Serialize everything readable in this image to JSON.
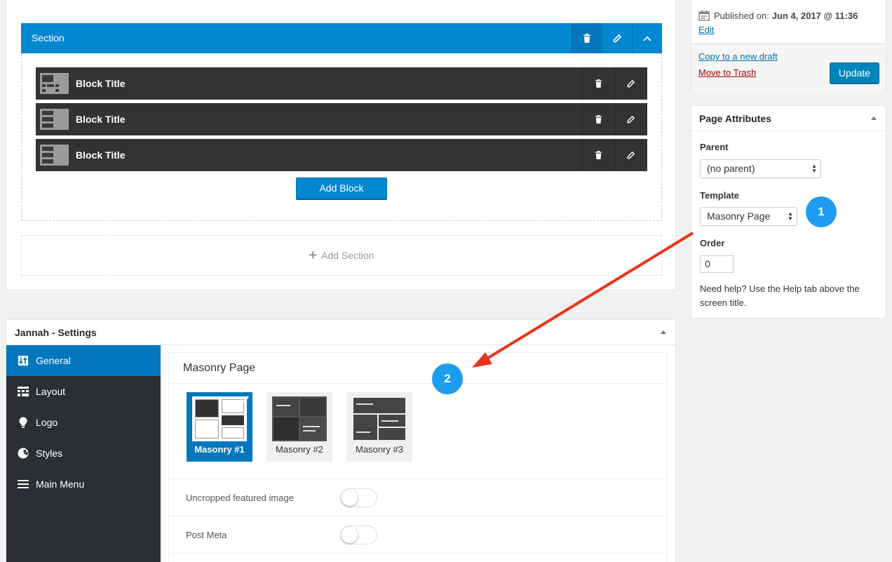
{
  "builder": {
    "section_label": "Section",
    "blocks": [
      {
        "title": "Block Title"
      },
      {
        "title": "Block Title"
      },
      {
        "title": "Block Title"
      }
    ],
    "add_block_label": "Add Block",
    "add_section_label": "Add Section"
  },
  "settings": {
    "title": "Jannah - Settings",
    "nav": [
      {
        "label": "General",
        "icon": "sliders-icon",
        "active": true
      },
      {
        "label": "Layout",
        "icon": "layout-grid-icon"
      },
      {
        "label": "Logo",
        "icon": "lightbulb-icon"
      },
      {
        "label": "Styles",
        "icon": "palette-icon"
      },
      {
        "label": "Main Menu",
        "icon": "hamburger-menu-icon"
      }
    ],
    "panel_title": "Masonry Page",
    "layouts": [
      {
        "label": "Masonry #1",
        "selected": true
      },
      {
        "label": "Masonry #2",
        "selected": false
      },
      {
        "label": "Masonry #3",
        "selected": false
      }
    ],
    "options": [
      {
        "label": "Uncropped featured image",
        "enabled": false
      },
      {
        "label": "Post Meta",
        "enabled": false
      }
    ]
  },
  "publish": {
    "published_label": "Published on:",
    "published_date": "Jun 4, 2017 @ 11:36",
    "edit_label": "Edit",
    "copy_label": "Copy to a new draft",
    "trash_label": "Move to Trash",
    "update_label": "Update"
  },
  "page_attributes": {
    "title": "Page Attributes",
    "parent_label": "Parent",
    "parent_value": "(no parent)",
    "template_label": "Template",
    "template_value": "Masonry Page",
    "order_label": "Order",
    "order_value": "0",
    "help_text": "Need help? Use the Help tab above the screen title."
  },
  "annotations": {
    "badge_1": "1",
    "badge_2": "2"
  },
  "colors": {
    "accent": "#0288d1",
    "accent_dark": "#0277bd",
    "badge": "#1e9cf0",
    "arrow": "#e8341c",
    "sidebar": "#2b2f33",
    "block": "#333333"
  }
}
